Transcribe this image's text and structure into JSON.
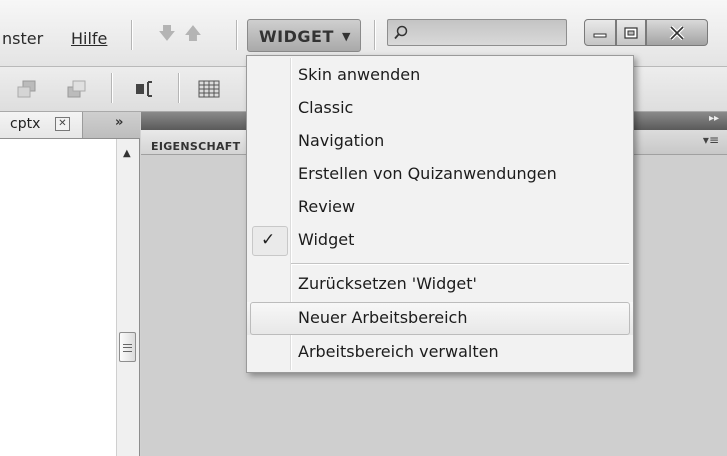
{
  "menubar": {
    "items": [
      {
        "label": "nster"
      },
      {
        "label": "Hilfe"
      }
    ]
  },
  "workspace_switcher": {
    "label": "WIDGET"
  },
  "search": {
    "value": "",
    "placeholder": ""
  },
  "left_panel": {
    "tab_label": "cptx",
    "close_glyph": "✕",
    "collapse_glyph": "»"
  },
  "right_panel": {
    "tab_label": "EIGENSCHAFT"
  },
  "dropdown": {
    "items": [
      {
        "label": "Skin anwenden",
        "checked": false
      },
      {
        "label": "Classic",
        "checked": false
      },
      {
        "label": "Navigation",
        "checked": false
      },
      {
        "label": "Erstellen von Quizanwendungen",
        "checked": false
      },
      {
        "label": "Review",
        "checked": false
      },
      {
        "label": "Widget",
        "checked": true
      },
      {
        "label": "Zurücksetzen 'Widget'",
        "checked": false
      },
      {
        "label": "Neuer Arbeitsbereich",
        "checked": false,
        "hovered": true
      },
      {
        "label": "Arbeitsbereich verwalten",
        "checked": false
      }
    ],
    "check_glyph": "✓"
  },
  "icons": {
    "prev": "arrow-down-icon",
    "next": "arrow-up-icon",
    "dropdown_caret": "caret-down-icon",
    "search": "search-icon",
    "minimize": "minimize-icon",
    "maximize": "maximize-icon",
    "close": "close-icon"
  },
  "colors": {
    "background": "#d2d2d2",
    "menu_bg": "#f2f2f2",
    "accent_dark": "#5a5a5a"
  }
}
